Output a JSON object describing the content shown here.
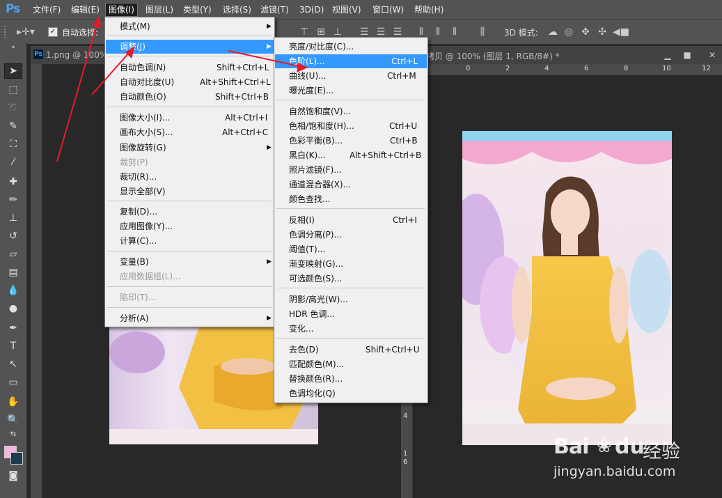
{
  "app": {
    "logo": "Ps"
  },
  "menubar": {
    "items": [
      "文件(F)",
      "编辑(E)",
      "图像(I)",
      "图层(L)",
      "类型(Y)",
      "选择(S)",
      "滤镜(T)",
      "3D(D)",
      "视图(V)",
      "窗口(W)",
      "帮助(H)"
    ],
    "active": "图像(I)"
  },
  "options_bar": {
    "auto_select_label": "自动选择:",
    "mode_3d_label": "3D 模式:"
  },
  "documents": {
    "left_title": "1.png @ 100%",
    "right_title": "拷贝 @ 100% (图层 1, RGB/8#) *",
    "ruler_top_right": [
      "0",
      "2",
      "4",
      "6",
      "8",
      "10",
      "12"
    ],
    "ruler_left_right": [
      "4",
      "1",
      "6"
    ]
  },
  "image_menu": {
    "items": [
      {
        "label": "模式(M)",
        "shortcut": "",
        "submenu": true,
        "disabled": false
      },
      {
        "label": "调整(J)",
        "shortcut": "",
        "submenu": true,
        "disabled": false,
        "highlighted": true
      },
      {
        "label": "自动色调(N)",
        "shortcut": "Shift+Ctrl+L"
      },
      {
        "label": "自动对比度(U)",
        "shortcut": "Alt+Shift+Ctrl+L"
      },
      {
        "label": "自动颜色(O)",
        "shortcut": "Shift+Ctrl+B"
      },
      {
        "label": "图像大小(I)...",
        "shortcut": "Alt+Ctrl+I"
      },
      {
        "label": "画布大小(S)...",
        "shortcut": "Alt+Ctrl+C"
      },
      {
        "label": "图像旋转(G)",
        "shortcut": "",
        "submenu": true
      },
      {
        "label": "裁剪(P)",
        "shortcut": "",
        "disabled": true
      },
      {
        "label": "裁切(R)...",
        "shortcut": ""
      },
      {
        "label": "显示全部(V)",
        "shortcut": ""
      },
      {
        "label": "复制(D)...",
        "shortcut": ""
      },
      {
        "label": "应用图像(Y)...",
        "shortcut": ""
      },
      {
        "label": "计算(C)...",
        "shortcut": ""
      },
      {
        "label": "变量(B)",
        "shortcut": "",
        "submenu": true
      },
      {
        "label": "应用数据组(L)...",
        "shortcut": "",
        "disabled": true
      },
      {
        "label": "陷印(T)...",
        "shortcut": "",
        "disabled": true
      },
      {
        "label": "分析(A)",
        "shortcut": "",
        "submenu": true
      }
    ]
  },
  "adjust_menu": {
    "items": [
      {
        "label": "亮度/对比度(C)...",
        "shortcut": ""
      },
      {
        "label": "色阶(L)...",
        "shortcut": "Ctrl+L",
        "highlighted": true
      },
      {
        "label": "曲线(U)...",
        "shortcut": "Ctrl+M"
      },
      {
        "label": "曝光度(E)...",
        "shortcut": ""
      },
      {
        "label": "自然饱和度(V)...",
        "shortcut": ""
      },
      {
        "label": "色相/饱和度(H)...",
        "shortcut": "Ctrl+U"
      },
      {
        "label": "色彩平衡(B)...",
        "shortcut": "Ctrl+B"
      },
      {
        "label": "黑白(K)...",
        "shortcut": "Alt+Shift+Ctrl+B"
      },
      {
        "label": "照片滤镜(F)...",
        "shortcut": ""
      },
      {
        "label": "通道混合器(X)...",
        "shortcut": ""
      },
      {
        "label": "颜色查找...",
        "shortcut": ""
      },
      {
        "label": "反相(I)",
        "shortcut": "Ctrl+I"
      },
      {
        "label": "色调分离(P)...",
        "shortcut": ""
      },
      {
        "label": "阈值(T)...",
        "shortcut": ""
      },
      {
        "label": "渐变映射(G)...",
        "shortcut": ""
      },
      {
        "label": "可选颜色(S)...",
        "shortcut": ""
      },
      {
        "label": "阴影/高光(W)...",
        "shortcut": ""
      },
      {
        "label": "HDR 色调...",
        "shortcut": ""
      },
      {
        "label": "变化...",
        "shortcut": ""
      },
      {
        "label": "去色(D)",
        "shortcut": "Shift+Ctrl+U"
      },
      {
        "label": "匹配颜色(M)...",
        "shortcut": ""
      },
      {
        "label": "替换颜色(R)...",
        "shortcut": ""
      },
      {
        "label": "色调均化(Q)",
        "shortcut": ""
      }
    ]
  },
  "watermark": {
    "brand": "Bai",
    "brand2": "du",
    "cn": "经验",
    "url": "jingyan.baidu.com"
  },
  "colors": {
    "highlight": "#3399ff",
    "arrow": "#e8182c",
    "fg_swatch": "#f5b7e0",
    "bg_swatch": "#1f3b4d"
  }
}
